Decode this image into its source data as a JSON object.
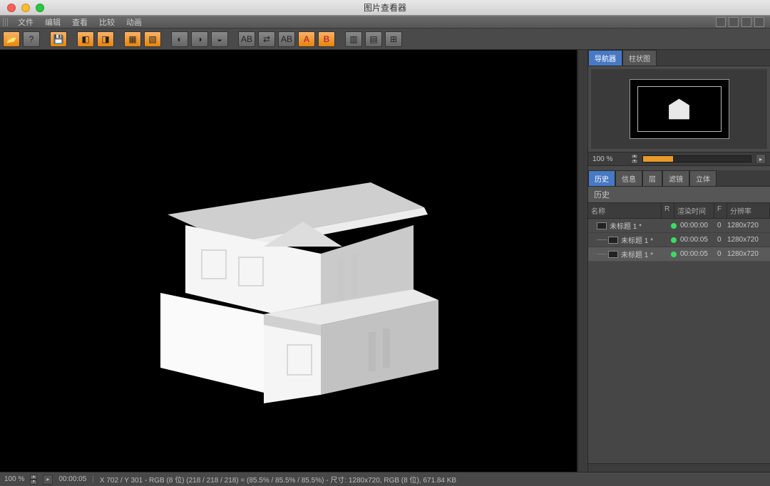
{
  "window": {
    "title": "图片查看器"
  },
  "menubar": {
    "items": [
      "文件",
      "编辑",
      "查看",
      "比较",
      "动画"
    ]
  },
  "sidebar": {
    "nav_tabs": [
      "导航器",
      "柱状图"
    ],
    "zoom_pct": "100 %",
    "panel_tabs": [
      "历史",
      "信息",
      "层",
      "滤镜",
      "立体"
    ],
    "section_title": "历史",
    "columns": {
      "name": "名称",
      "r": "R",
      "render_time": "渲染时间",
      "f": "F",
      "res": "分辨率"
    },
    "rows": [
      {
        "name": "未标题 1 *",
        "render_time": "00:00:00",
        "f": "0",
        "res": "1280x720"
      },
      {
        "name": "未标题 1 *",
        "render_time": "00:00:05",
        "f": "0",
        "res": "1280x720"
      },
      {
        "name": "未标题 1 *",
        "render_time": "00:00:05",
        "f": "0",
        "res": "1280x720"
      }
    ]
  },
  "status": {
    "zoom": "100 %",
    "time": "00:00:05",
    "info": "X 702 / Y 301 - RGB (8 位) (218 / 218 / 218) = (85.5% / 85.5% / 85.5%) - 尺寸: 1280x720, RGB (8 位), 671.84 KB"
  }
}
